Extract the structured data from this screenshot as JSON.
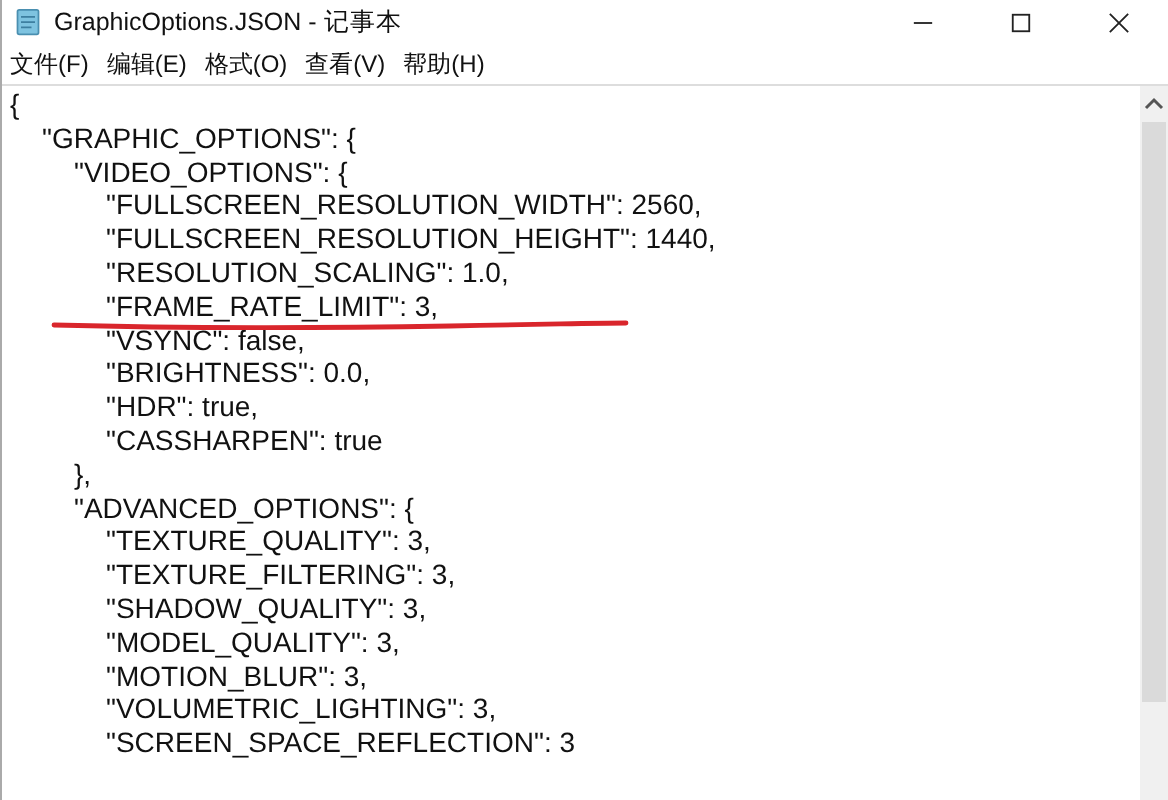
{
  "window": {
    "title": "GraphicOptions.JSON - 记事本"
  },
  "menu": [
    {
      "label": "文件(F)"
    },
    {
      "label": "编辑(E)"
    },
    {
      "label": "格式(O)"
    },
    {
      "label": "查看(V)"
    },
    {
      "label": "帮助(H)"
    }
  ],
  "document": {
    "lines": [
      {
        "text": "{",
        "children": [
          {
            "text": "\"GRAPHIC_OPTIONS\": {",
            "children": [
              {
                "text": "\"VIDEO_OPTIONS\": {",
                "children": [
                  {
                    "text": "\"FULLSCREEN_RESOLUTION_WIDTH\": 2560,"
                  },
                  {
                    "text": "\"FULLSCREEN_RESOLUTION_HEIGHT\": 1440,"
                  },
                  {
                    "text": "\"RESOLUTION_SCALING\": 1.0,"
                  },
                  {
                    "text": "\"FRAME_RATE_LIMIT\": 3,"
                  },
                  {
                    "text": "\"VSYNC\": false,"
                  },
                  {
                    "text": "\"BRIGHTNESS\": 0.0,"
                  },
                  {
                    "text": "\"HDR\": true,"
                  },
                  {
                    "text": "\"CASSHARPEN\": true"
                  }
                ]
              },
              {
                "text": "},"
              },
              {
                "text": "\"ADVANCED_OPTIONS\": {",
                "children": [
                  {
                    "text": "\"TEXTURE_QUALITY\": 3,"
                  },
                  {
                    "text": "\"TEXTURE_FILTERING\": 3,"
                  },
                  {
                    "text": "\"SHADOW_QUALITY\": 3,"
                  },
                  {
                    "text": "\"MODEL_QUALITY\": 3,"
                  },
                  {
                    "text": "\"MOTION_BLUR\": 3,"
                  },
                  {
                    "text": "\"VOLUMETRIC_LIGHTING\": 3,"
                  },
                  {
                    "text": "\"SCREEN_SPACE_REFLECTION\": 3"
                  }
                ]
              }
            ]
          }
        ]
      }
    ]
  }
}
